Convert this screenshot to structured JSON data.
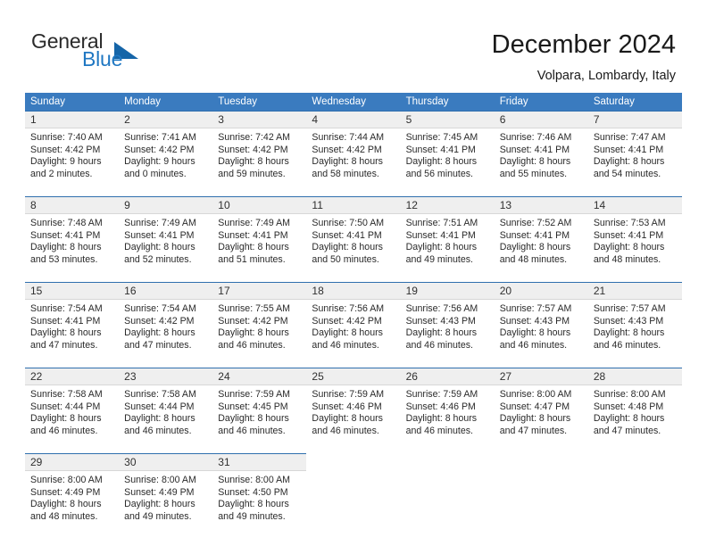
{
  "brand": {
    "name_top": "General",
    "name_bottom": "Blue",
    "accent_color": "#1f77c2",
    "triangle_color": "#1565a8"
  },
  "header": {
    "title": "December 2024",
    "location": "Volpara, Lombardy, Italy"
  },
  "calendar": {
    "header_bg": "#3a7bbf",
    "date_band_bg": "#efefef",
    "cell_top_border": "#2f6fae",
    "weekdays": [
      "Sunday",
      "Monday",
      "Tuesday",
      "Wednesday",
      "Thursday",
      "Friday",
      "Saturday"
    ],
    "weeks": [
      [
        {
          "date": "1",
          "sunrise": "Sunrise: 7:40 AM",
          "sunset": "Sunset: 4:42 PM",
          "daylight_1": "Daylight: 9 hours",
          "daylight_2": "and 2 minutes."
        },
        {
          "date": "2",
          "sunrise": "Sunrise: 7:41 AM",
          "sunset": "Sunset: 4:42 PM",
          "daylight_1": "Daylight: 9 hours",
          "daylight_2": "and 0 minutes."
        },
        {
          "date": "3",
          "sunrise": "Sunrise: 7:42 AM",
          "sunset": "Sunset: 4:42 PM",
          "daylight_1": "Daylight: 8 hours",
          "daylight_2": "and 59 minutes."
        },
        {
          "date": "4",
          "sunrise": "Sunrise: 7:44 AM",
          "sunset": "Sunset: 4:42 PM",
          "daylight_1": "Daylight: 8 hours",
          "daylight_2": "and 58 minutes."
        },
        {
          "date": "5",
          "sunrise": "Sunrise: 7:45 AM",
          "sunset": "Sunset: 4:41 PM",
          "daylight_1": "Daylight: 8 hours",
          "daylight_2": "and 56 minutes."
        },
        {
          "date": "6",
          "sunrise": "Sunrise: 7:46 AM",
          "sunset": "Sunset: 4:41 PM",
          "daylight_1": "Daylight: 8 hours",
          "daylight_2": "and 55 minutes."
        },
        {
          "date": "7",
          "sunrise": "Sunrise: 7:47 AM",
          "sunset": "Sunset: 4:41 PM",
          "daylight_1": "Daylight: 8 hours",
          "daylight_2": "and 54 minutes."
        }
      ],
      [
        {
          "date": "8",
          "sunrise": "Sunrise: 7:48 AM",
          "sunset": "Sunset: 4:41 PM",
          "daylight_1": "Daylight: 8 hours",
          "daylight_2": "and 53 minutes."
        },
        {
          "date": "9",
          "sunrise": "Sunrise: 7:49 AM",
          "sunset": "Sunset: 4:41 PM",
          "daylight_1": "Daylight: 8 hours",
          "daylight_2": "and 52 minutes."
        },
        {
          "date": "10",
          "sunrise": "Sunrise: 7:49 AM",
          "sunset": "Sunset: 4:41 PM",
          "daylight_1": "Daylight: 8 hours",
          "daylight_2": "and 51 minutes."
        },
        {
          "date": "11",
          "sunrise": "Sunrise: 7:50 AM",
          "sunset": "Sunset: 4:41 PM",
          "daylight_1": "Daylight: 8 hours",
          "daylight_2": "and 50 minutes."
        },
        {
          "date": "12",
          "sunrise": "Sunrise: 7:51 AM",
          "sunset": "Sunset: 4:41 PM",
          "daylight_1": "Daylight: 8 hours",
          "daylight_2": "and 49 minutes."
        },
        {
          "date": "13",
          "sunrise": "Sunrise: 7:52 AM",
          "sunset": "Sunset: 4:41 PM",
          "daylight_1": "Daylight: 8 hours",
          "daylight_2": "and 48 minutes."
        },
        {
          "date": "14",
          "sunrise": "Sunrise: 7:53 AM",
          "sunset": "Sunset: 4:41 PM",
          "daylight_1": "Daylight: 8 hours",
          "daylight_2": "and 48 minutes."
        }
      ],
      [
        {
          "date": "15",
          "sunrise": "Sunrise: 7:54 AM",
          "sunset": "Sunset: 4:41 PM",
          "daylight_1": "Daylight: 8 hours",
          "daylight_2": "and 47 minutes."
        },
        {
          "date": "16",
          "sunrise": "Sunrise: 7:54 AM",
          "sunset": "Sunset: 4:42 PM",
          "daylight_1": "Daylight: 8 hours",
          "daylight_2": "and 47 minutes."
        },
        {
          "date": "17",
          "sunrise": "Sunrise: 7:55 AM",
          "sunset": "Sunset: 4:42 PM",
          "daylight_1": "Daylight: 8 hours",
          "daylight_2": "and 46 minutes."
        },
        {
          "date": "18",
          "sunrise": "Sunrise: 7:56 AM",
          "sunset": "Sunset: 4:42 PM",
          "daylight_1": "Daylight: 8 hours",
          "daylight_2": "and 46 minutes."
        },
        {
          "date": "19",
          "sunrise": "Sunrise: 7:56 AM",
          "sunset": "Sunset: 4:43 PM",
          "daylight_1": "Daylight: 8 hours",
          "daylight_2": "and 46 minutes."
        },
        {
          "date": "20",
          "sunrise": "Sunrise: 7:57 AM",
          "sunset": "Sunset: 4:43 PM",
          "daylight_1": "Daylight: 8 hours",
          "daylight_2": "and 46 minutes."
        },
        {
          "date": "21",
          "sunrise": "Sunrise: 7:57 AM",
          "sunset": "Sunset: 4:43 PM",
          "daylight_1": "Daylight: 8 hours",
          "daylight_2": "and 46 minutes."
        }
      ],
      [
        {
          "date": "22",
          "sunrise": "Sunrise: 7:58 AM",
          "sunset": "Sunset: 4:44 PM",
          "daylight_1": "Daylight: 8 hours",
          "daylight_2": "and 46 minutes."
        },
        {
          "date": "23",
          "sunrise": "Sunrise: 7:58 AM",
          "sunset": "Sunset: 4:44 PM",
          "daylight_1": "Daylight: 8 hours",
          "daylight_2": "and 46 minutes."
        },
        {
          "date": "24",
          "sunrise": "Sunrise: 7:59 AM",
          "sunset": "Sunset: 4:45 PM",
          "daylight_1": "Daylight: 8 hours",
          "daylight_2": "and 46 minutes."
        },
        {
          "date": "25",
          "sunrise": "Sunrise: 7:59 AM",
          "sunset": "Sunset: 4:46 PM",
          "daylight_1": "Daylight: 8 hours",
          "daylight_2": "and 46 minutes."
        },
        {
          "date": "26",
          "sunrise": "Sunrise: 7:59 AM",
          "sunset": "Sunset: 4:46 PM",
          "daylight_1": "Daylight: 8 hours",
          "daylight_2": "and 46 minutes."
        },
        {
          "date": "27",
          "sunrise": "Sunrise: 8:00 AM",
          "sunset": "Sunset: 4:47 PM",
          "daylight_1": "Daylight: 8 hours",
          "daylight_2": "and 47 minutes."
        },
        {
          "date": "28",
          "sunrise": "Sunrise: 8:00 AM",
          "sunset": "Sunset: 4:48 PM",
          "daylight_1": "Daylight: 8 hours",
          "daylight_2": "and 47 minutes."
        }
      ],
      [
        {
          "date": "29",
          "sunrise": "Sunrise: 8:00 AM",
          "sunset": "Sunset: 4:49 PM",
          "daylight_1": "Daylight: 8 hours",
          "daylight_2": "and 48 minutes."
        },
        {
          "date": "30",
          "sunrise": "Sunrise: 8:00 AM",
          "sunset": "Sunset: 4:49 PM",
          "daylight_1": "Daylight: 8 hours",
          "daylight_2": "and 49 minutes."
        },
        {
          "date": "31",
          "sunrise": "Sunrise: 8:00 AM",
          "sunset": "Sunset: 4:50 PM",
          "daylight_1": "Daylight: 8 hours",
          "daylight_2": "and 49 minutes."
        },
        {
          "date": "",
          "sunrise": "",
          "sunset": "",
          "daylight_1": "",
          "daylight_2": ""
        },
        {
          "date": "",
          "sunrise": "",
          "sunset": "",
          "daylight_1": "",
          "daylight_2": ""
        },
        {
          "date": "",
          "sunrise": "",
          "sunset": "",
          "daylight_1": "",
          "daylight_2": ""
        },
        {
          "date": "",
          "sunrise": "",
          "sunset": "",
          "daylight_1": "",
          "daylight_2": ""
        }
      ]
    ]
  }
}
